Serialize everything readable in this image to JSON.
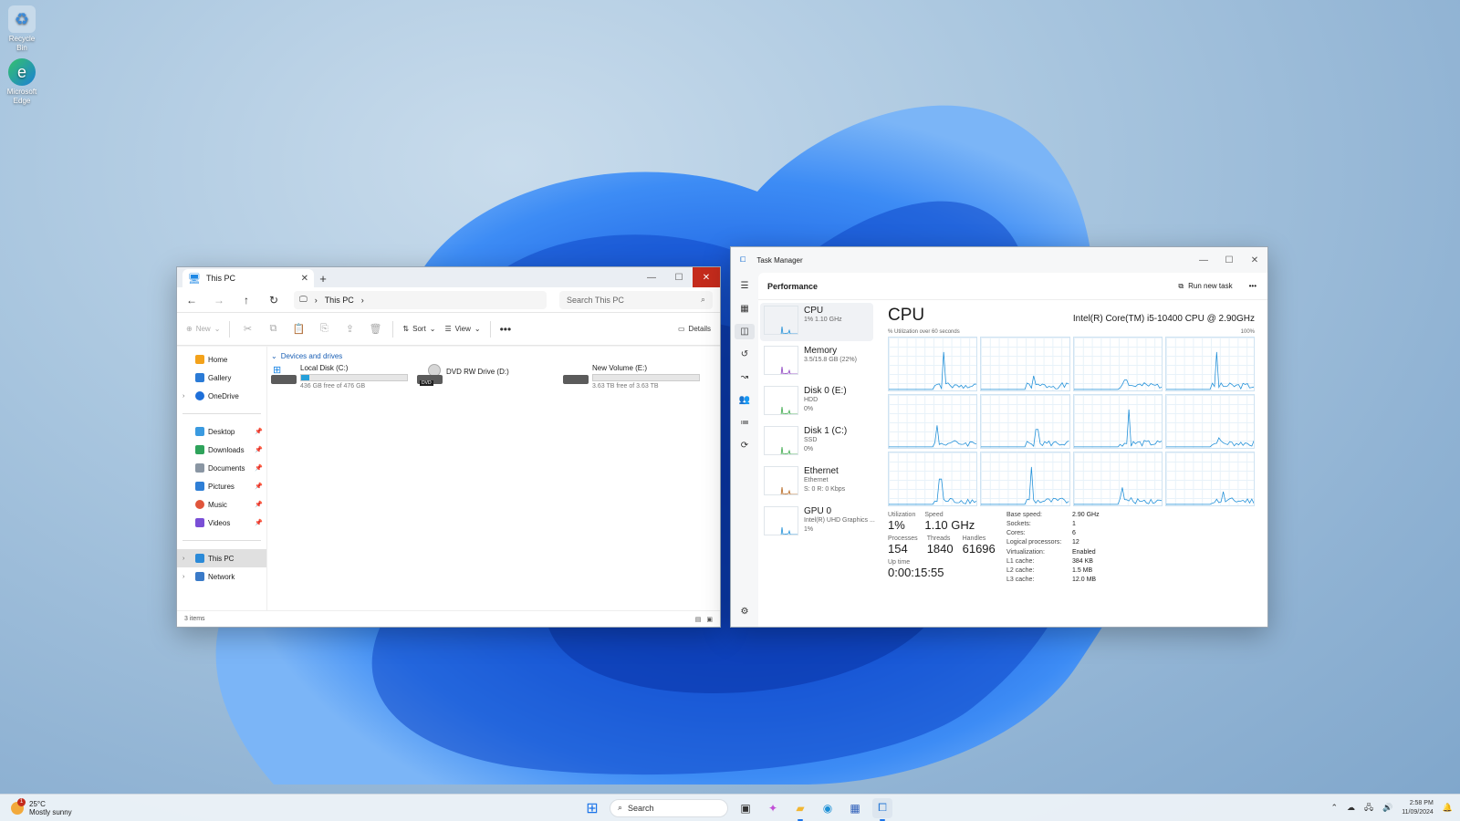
{
  "desktop": {
    "icons": [
      {
        "label": "Recycle Bin",
        "icon": "recycle-bin-icon"
      },
      {
        "label": "Microsoft Edge",
        "icon": "edge-icon"
      }
    ]
  },
  "explorer": {
    "tab_title": "This PC",
    "address": "This PC",
    "search_placeholder": "Search This PC",
    "commands": {
      "new": "New",
      "sort": "Sort",
      "view": "View",
      "details": "Details"
    },
    "nav": {
      "home": "Home",
      "gallery": "Gallery",
      "onedrive": "OneDrive",
      "desktop": "Desktop",
      "downloads": "Downloads",
      "documents": "Documents",
      "pictures": "Pictures",
      "music": "Music",
      "videos": "Videos",
      "thispc": "This PC",
      "network": "Network"
    },
    "group_header": "Devices and drives",
    "drives": [
      {
        "name": "Local Disk (C:)",
        "free": "436 GB free of 476 GB",
        "used_fraction": 0.08
      },
      {
        "name": "DVD RW Drive (D:)"
      },
      {
        "name": "New Volume (E:)",
        "free": "3.63 TB free of 3.63 TB",
        "used_fraction": 0.0
      }
    ],
    "status": "3 items"
  },
  "taskmanager": {
    "title": "Task Manager",
    "section": "Performance",
    "run_new_task": "Run new task",
    "resources": [
      {
        "name": "CPU",
        "sub1": "1%  1.10 GHz",
        "sub2": "",
        "sub3": ""
      },
      {
        "name": "Memory",
        "sub1": "3.5/15.8 GB (22%)",
        "sub2": "",
        "sub3": ""
      },
      {
        "name": "Disk 0 (E:)",
        "sub1": "HDD",
        "sub2": "0%",
        "sub3": ""
      },
      {
        "name": "Disk 1 (C:)",
        "sub1": "SSD",
        "sub2": "0%",
        "sub3": ""
      },
      {
        "name": "Ethernet",
        "sub1": "Ethernet",
        "sub2": "S: 0  R: 0 Kbps",
        "sub3": ""
      },
      {
        "name": "GPU 0",
        "sub1": "Intel(R) UHD Graphics ...",
        "sub2": "1%",
        "sub3": ""
      }
    ],
    "cpu": {
      "heading": "CPU",
      "model": "Intel(R) Core(TM) i5-10400 CPU @ 2.90GHz",
      "graph_caption": "% Utilization over 60 seconds",
      "graph_max": "100%",
      "utilization_label": "Utilization",
      "utilization": "1%",
      "speed_label": "Speed",
      "speed": "1.10 GHz",
      "processes_label": "Processes",
      "processes": "154",
      "threads_label": "Threads",
      "threads": "1840",
      "handles_label": "Handles",
      "handles": "61696",
      "uptime_label": "Up time",
      "uptime": "0:00:15:55",
      "specs": [
        {
          "k": "Base speed:",
          "v": "2.90 GHz"
        },
        {
          "k": "Sockets:",
          "v": "1"
        },
        {
          "k": "Cores:",
          "v": "6"
        },
        {
          "k": "Logical processors:",
          "v": "12"
        },
        {
          "k": "Virtualization:",
          "v": "Enabled"
        },
        {
          "k": "L1 cache:",
          "v": "384 KB"
        },
        {
          "k": "L2 cache:",
          "v": "1.5 MB"
        },
        {
          "k": "L3 cache:",
          "v": "12.0 MB"
        }
      ]
    }
  },
  "taskbar": {
    "temp": "25°C",
    "weather": "Mostly sunny",
    "weather_badge": "1",
    "search": "Search",
    "time": "2:58 PM",
    "date": "11/09/2024"
  },
  "colors": {
    "accent": "#1a73e8",
    "close": "#c42b1c",
    "graph_line": "#1f8fd8"
  }
}
